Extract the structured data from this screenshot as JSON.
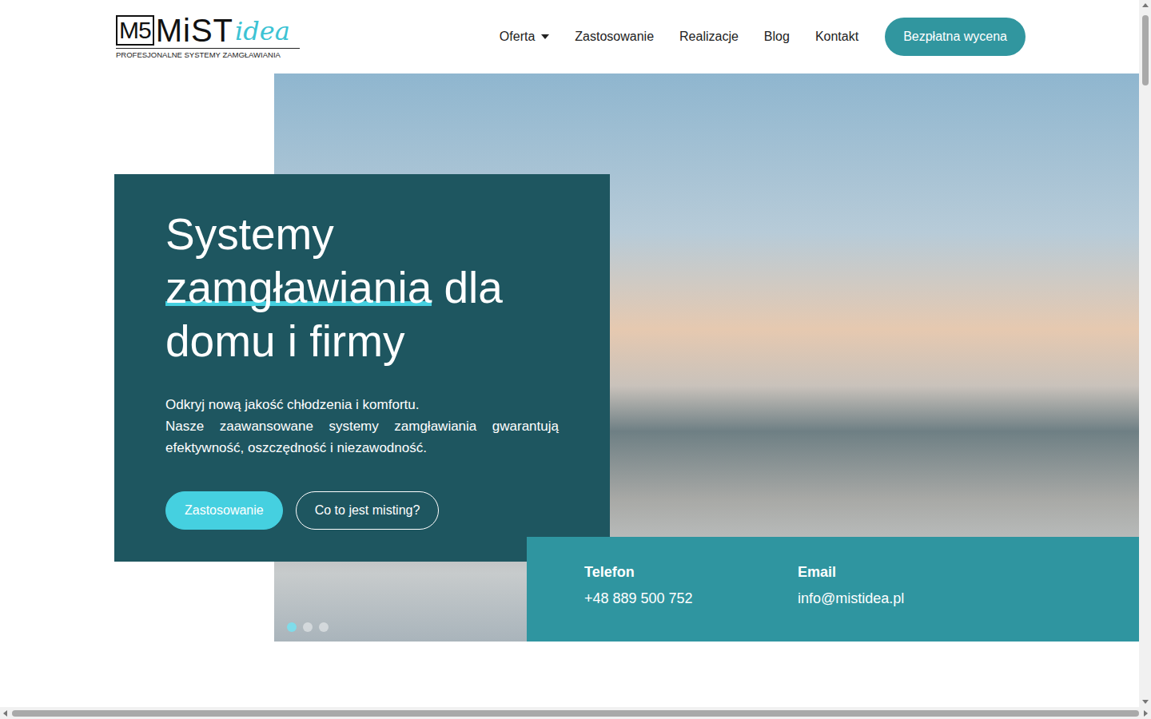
{
  "logo": {
    "mark": "M5",
    "name": "MiST",
    "accent": "idea",
    "tagline": "PROFESJONALNE SYSTEMY ZAMGŁAWIANIA"
  },
  "nav": [
    {
      "label": "Oferta",
      "dropdown": true
    },
    {
      "label": "Zastosowanie",
      "dropdown": false
    },
    {
      "label": "Realizacje",
      "dropdown": false
    },
    {
      "label": "Blog",
      "dropdown": false
    },
    {
      "label": "Kontakt",
      "dropdown": false
    }
  ],
  "cta": "Bezpłatna wycena",
  "hero": {
    "title_before": "Systemy ",
    "title_highlight": "zamgławiania",
    "title_after": " dla domu i firmy",
    "lead": "Odkryj nową jakość chłodzenia i komfortu.",
    "body": "Nasze zaawansowane systemy zamgławiania gwarantują efektywność, oszczędność i niezawodność.",
    "buttons": [
      {
        "label": "Zastosowanie",
        "kind": "filled"
      },
      {
        "label": "Co to jest misting?",
        "kind": "outline"
      }
    ]
  },
  "slider": {
    "dots": [
      {
        "selected": true
      },
      {
        "selected": false
      },
      {
        "selected": false
      }
    ]
  },
  "contact": [
    {
      "label": "Telefon",
      "value": "+48 889 500 752"
    },
    {
      "label": "Email",
      "value": "info@mistidea.pl"
    }
  ]
}
